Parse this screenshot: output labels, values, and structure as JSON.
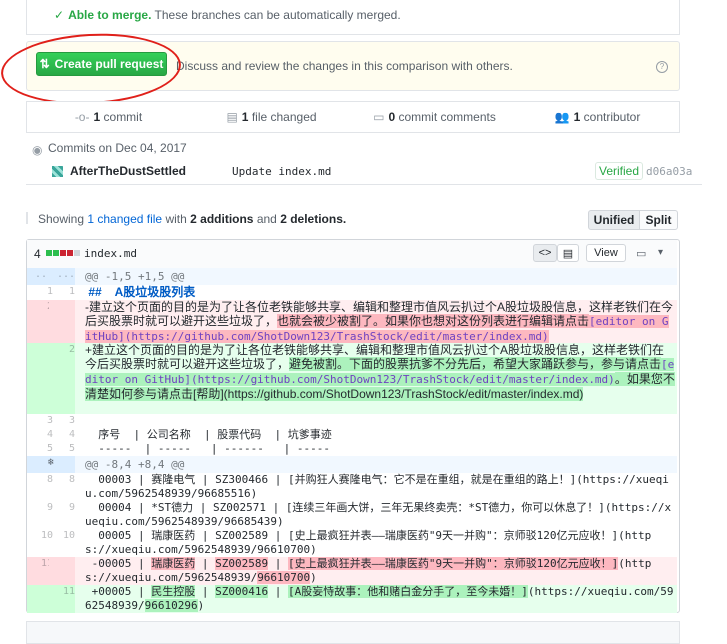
{
  "merge": {
    "status": "Able to merge.",
    "detail": "These branches can be automatically merged."
  },
  "pull_request": {
    "button_label": "Create pull request",
    "description": "Discuss and review the changes in this comparison with others."
  },
  "stats": {
    "commits": {
      "count": "1",
      "label": "commit"
    },
    "files": {
      "count": "1",
      "label": "file changed"
    },
    "comments": {
      "count": "0",
      "label": "commit comments"
    },
    "contributors": {
      "count": "1",
      "label": "contributor"
    }
  },
  "commits": {
    "date_label": "Commits on Dec 04, 2017",
    "items": [
      {
        "author": "AfterTheDustSettled",
        "message": "Update index.md",
        "badge": "Verified",
        "sha": "d06a03a"
      }
    ]
  },
  "summary": {
    "prefix": "Showing",
    "changed": "1 changed file",
    "with": "with",
    "additions": "2 additions",
    "and": "and",
    "deletions": "2 deletions."
  },
  "view_toggle": {
    "unified": "Unified",
    "split": "Split"
  },
  "file": {
    "change_count": "4",
    "name": "index.md",
    "view_label": "View",
    "diffstat_colors": [
      "#2cbe4e",
      "#2cbe4e",
      "#cb2431",
      "#cb2431",
      "#d1d5da"
    ]
  },
  "diff": {
    "hunk1": "@@ -1,5 +1,5 @@",
    "l1": {
      "o": "1",
      "n": "1",
      "text": " ##    A股垃圾股列表"
    },
    "l2del": {
      "o": "2",
      "n": "",
      "pre": "-建立这个页面的目的是为了让各位老铁能够共享、编辑和整理市值风云扒过个A股垃圾股信息，这样老铁们在今后买股票时就可以避开这些垃圾了，",
      "mid": "也就会被少被割了。如果你也想对这份列表进行编辑请点击",
      "link": "[editor on GitHub](https://github.com/ShotDown123/TrashStock/edit/master/index.md)"
    },
    "l2add": {
      "o": "",
      "n": "2",
      "pre": "+建立这个页面的目的是为了让各位老铁能够共享、编辑和整理市值风云扒过个A股垃圾股信息，这样老铁们在今后买股票时就可以避开这些垃圾了，",
      "mid": "避免被割。下面的股票抗爹不分先后，希望大家踊跃参与，参与请点击",
      "link": "[editor on GitHub](https://github.com/ShotDown123/TrashStock/edit/master/index.md)",
      "post": "。如果您不清楚如何参与请点击[帮助](https://github.com/ShotDown123/TrashStock/edit/master/index.md)"
    },
    "l3": {
      "o": "3",
      "n": "3",
      "text": ""
    },
    "l4": {
      "o": "4",
      "n": "4",
      "text": "  序号  | 公司名称  | 股票代码  | 坑爹事迹"
    },
    "l5": {
      "o": "5",
      "n": "5",
      "text": "  -----  | -----   | ------   | -----"
    },
    "hunk2": "@@ -8,4 +8,4 @@",
    "l8": {
      "o": "8",
      "n": "8",
      "text": "  00003 | 赛隆电气 | SZ300466 | [并购狂人赛隆电气：它不是在重组，就是在重组的路上！](https://xueqiu.com/5962548939/96685516)"
    },
    "l9": {
      "o": "9",
      "n": "9",
      "text": "  00004 | *ST德力 | SZ002571 | [连续三年画大饼，三年无果终卖壳：*ST德力，你可以休息了！](https://xueqiu.com/5962548939/96685439)"
    },
    "l10": {
      "o": "10",
      "n": "10",
      "text": "  00005 | 瑞康医药 | SZ002589 | [史上最疯狂并表——瑞康医药\"9天一并购\"：京师驳120亿元应收！](https://xueqiu.com/5962548939/96610700)"
    },
    "l11del": {
      "o": "11",
      "n": "",
      "pre": " -00005 | ",
      "x1": "瑞康医药",
      "m1": " | ",
      "x2": "SZ002589",
      "m2": " | ",
      "x3": "[史上最疯狂并表——瑞康医药\"9天一并购\"：京师驳120亿元应收！]",
      "m3": "(https://xueqiu.com/5962548939/",
      "x4": "96610700",
      "m4": ")"
    },
    "l11add": {
      "o": "",
      "n": "11",
      "pre": " +00005 | ",
      "x1": "民生控股",
      "m1": " | ",
      "x2": "SZ000416",
      "m2": " | ",
      "x3": "[A股妄恃故事：他和赌白金分手了，至今未婚！]",
      "m3": "(https://xueqiu.com/5962548939/",
      "x4": "96610296",
      "m4": ")"
    }
  }
}
